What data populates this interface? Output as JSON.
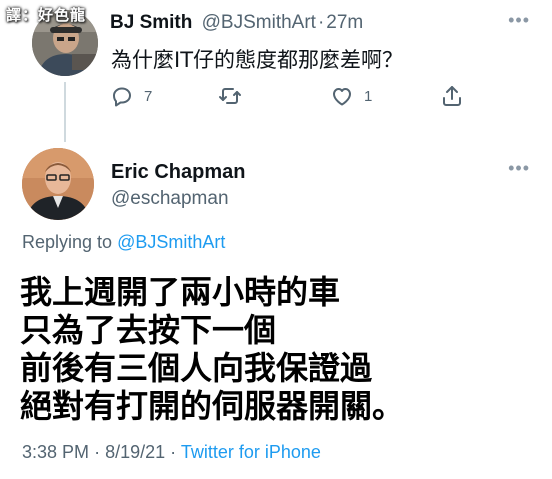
{
  "watermark": "譯：好色龍",
  "parent_tweet": {
    "name": "BJ Smith",
    "handle": "@BJSmithArt",
    "separator": "·",
    "time": "27m",
    "text": "為什麼IT仔的態度都那麼差啊？",
    "replies": "7",
    "likes": "1"
  },
  "main_tweet": {
    "name": "Eric Chapman",
    "handle": "@eschapman",
    "replying_prefix": "Replying to",
    "replying_to": "@BJSmithArt",
    "lines": [
      "我上週開了兩小時的車",
      "只為了去按下一個",
      "前後有三個人向我保證過",
      "絕對有打開的伺服器開關。"
    ],
    "time": "3:38 PM",
    "sep1": "·",
    "date": "8/19/21",
    "sep2": "·",
    "source": "Twitter for iPhone"
  },
  "colors": {
    "accent": "#1d9bf0",
    "secondary_text": "#536471",
    "icon": "#536471",
    "thread_line": "#cfd9de"
  },
  "icons": [
    "reply-icon",
    "retweet-icon",
    "like-icon",
    "share-icon",
    "more-icon"
  ]
}
